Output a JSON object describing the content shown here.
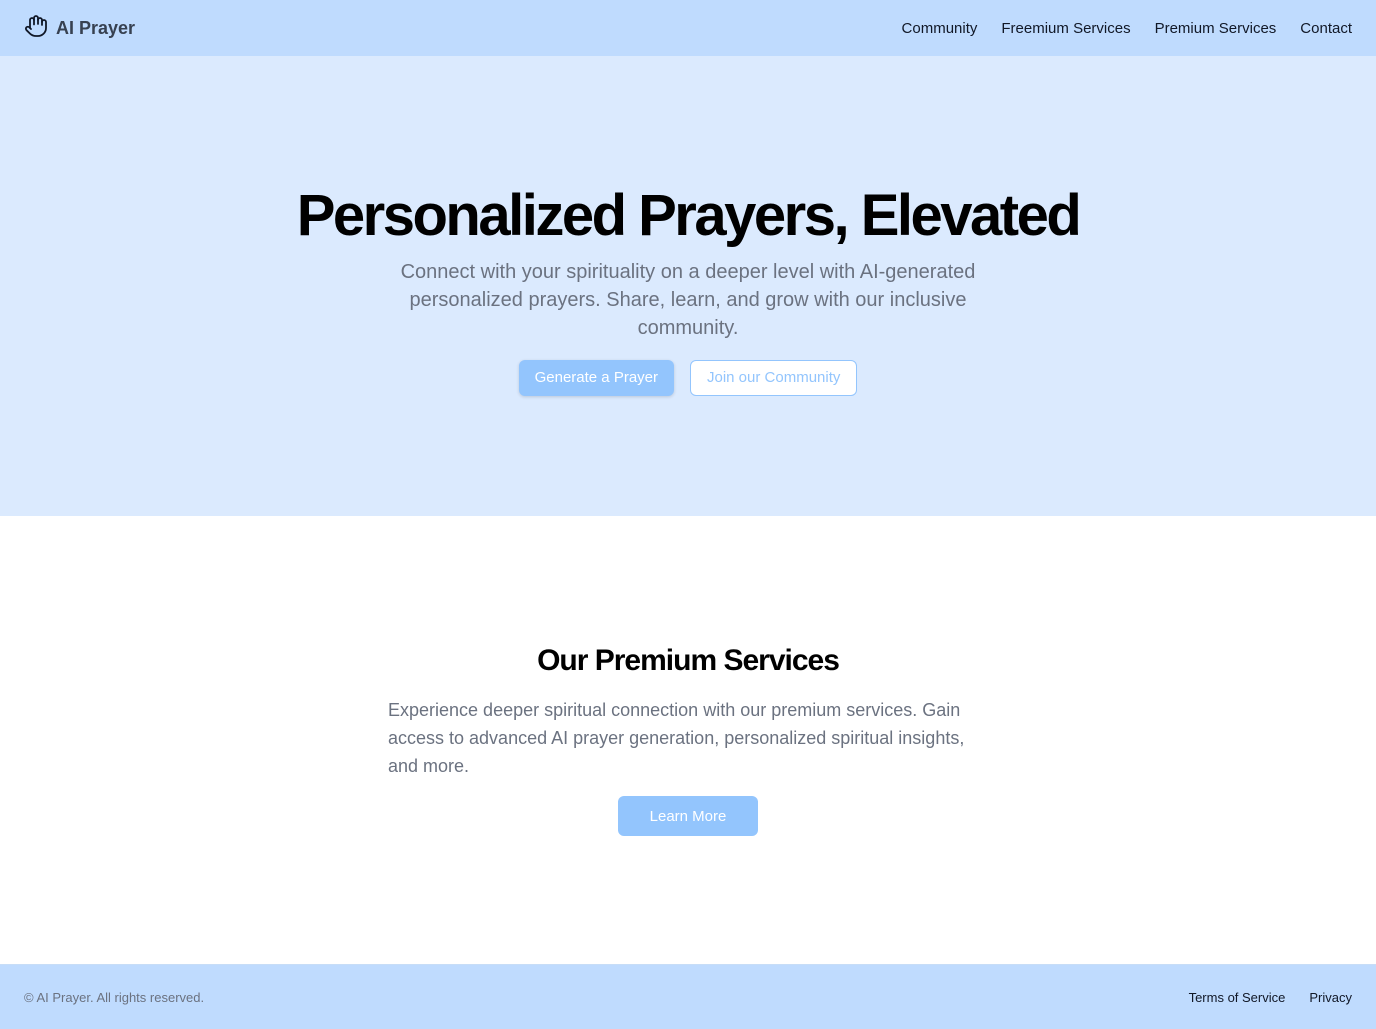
{
  "header": {
    "brand": "AI Prayer",
    "brand_icon": "hand-icon",
    "nav": [
      "Community",
      "Freemium Services",
      "Premium Services",
      "Contact"
    ]
  },
  "hero": {
    "title": "Personalized Prayers, Elevated",
    "subtitle": "Connect with your spirituality on a deeper level with AI-generated personalized prayers. Share, learn, and grow with our inclusive community.",
    "primary_button": "Generate a Prayer",
    "secondary_button": "Join our Community"
  },
  "premium": {
    "title": "Our Premium Services",
    "description": "Experience deeper spiritual connection with our premium services. Gain access to advanced AI prayer generation, personalized spiritual insights, and more.",
    "button": "Learn More"
  },
  "footer": {
    "copyright": "© AI Prayer. All rights reserved.",
    "links": [
      "Terms of Service",
      "Privacy"
    ]
  },
  "colors": {
    "header_bg": "#bfdbfe",
    "hero_bg": "#dbeafe",
    "accent": "#93c5fd",
    "muted_text": "#6b7280"
  }
}
